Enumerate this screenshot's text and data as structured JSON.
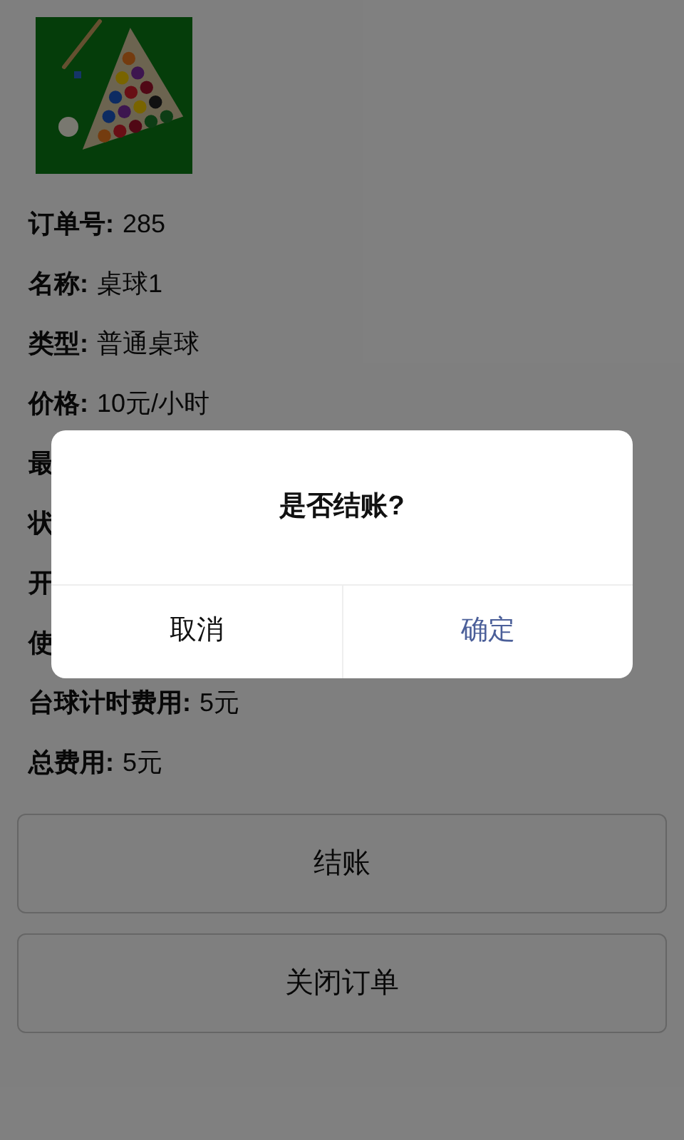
{
  "fields": [
    {
      "label": "订单号:",
      "value": "285"
    },
    {
      "label": "名称:",
      "value": "桌球1"
    },
    {
      "label": "类型:",
      "value": "普通桌球"
    },
    {
      "label": "价格:",
      "value": "10元/小时"
    },
    {
      "label": "最"
    },
    {
      "label": "状"
    },
    {
      "label": "开"
    },
    {
      "label": "使"
    },
    {
      "label": "台球计时费用:",
      "value": "5元"
    },
    {
      "label": "总费用:",
      "value": "5元"
    }
  ],
  "buttons": [
    "结账",
    "关闭订单"
  ],
  "dialog": {
    "message": "是否结账?",
    "cancel": "取消",
    "confirm": "确定"
  }
}
